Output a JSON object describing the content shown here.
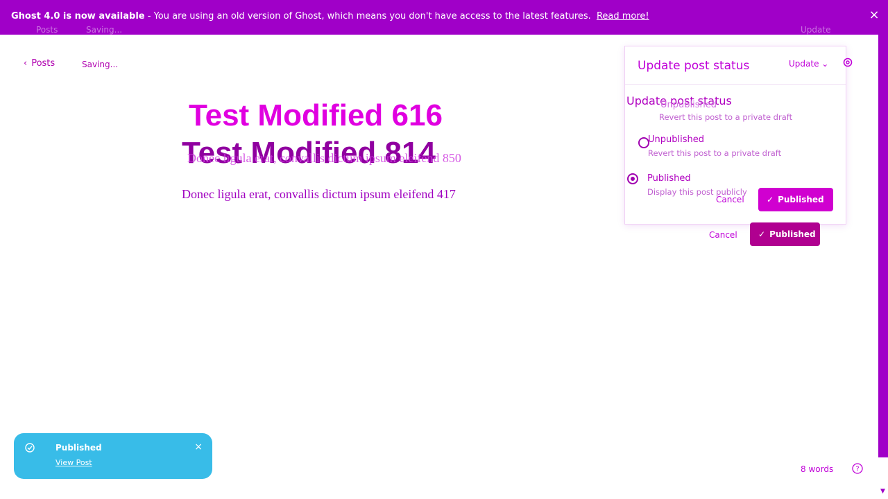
{
  "banner": {
    "headline": "Ghost 4.0 is now available",
    "message": "- You are using an old version of Ghost, which means you don't have access to the latest features.",
    "link": "Read more!",
    "ghost_left_1": "Posts",
    "ghost_left_2": "Saving...",
    "ghost_right": "Update"
  },
  "editor": {
    "back_label": "Posts",
    "status": "Saving...",
    "title_front": "Test Modified 616",
    "title_back": "Test Modified 814",
    "body_ghost": "Donec ligula erat, convallis dictum ipsum eleifend 850",
    "body": "Donec ligula erat, convallis dictum ipsum eleifend 417",
    "word_count": "8 words"
  },
  "popover": {
    "title": "Update post status",
    "update_label": "Update",
    "duplicate_title": "Update post status",
    "options": [
      {
        "label": "Unpublished",
        "desc": "Revert this post to a private draft",
        "selected": false
      },
      {
        "label": "Published",
        "desc": "Display this post publicly",
        "selected": true
      }
    ],
    "ghost_option_label": "Unpublished",
    "ghost_option_desc": "Revert this post to a private draft",
    "cancel_label": "Cancel",
    "publish_label": "Published"
  },
  "toast": {
    "title": "Published",
    "link": "View Post"
  },
  "colors": {
    "accent": "#a000c8",
    "publish_button": "#d000d0",
    "publish_button_back": "#b00090",
    "toast": "#38bce8"
  }
}
